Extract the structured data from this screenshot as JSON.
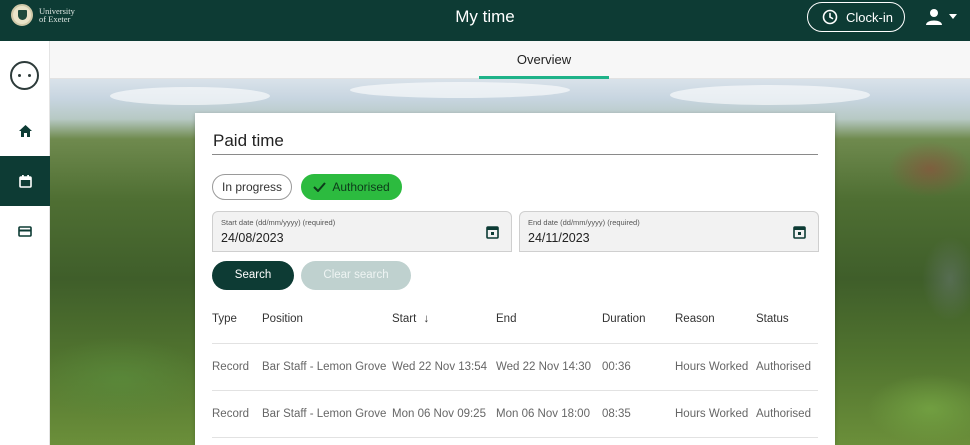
{
  "header": {
    "logo_text_line1": "University",
    "logo_text_line2": "of Exeter",
    "title": "My time",
    "clockin_label": "Clock-in"
  },
  "sidebar": {
    "items": [
      {
        "name": "home",
        "icon": "home-icon",
        "active": false
      },
      {
        "name": "calendar",
        "icon": "calendar-icon",
        "active": true
      },
      {
        "name": "card",
        "icon": "card-icon",
        "active": false
      }
    ]
  },
  "tabs": [
    {
      "label": "Overview",
      "active": true
    }
  ],
  "card": {
    "title": "Paid time",
    "filters": {
      "in_progress": "In progress",
      "authorised": "Authorised"
    },
    "start_date": {
      "label": "Start date (dd/mm/yyyy) (required)",
      "value": "24/08/2023"
    },
    "end_date": {
      "label": "End date (dd/mm/yyyy) (required)",
      "value": "24/11/2023"
    },
    "search_label": "Search",
    "clear_label": "Clear search",
    "table": {
      "columns": [
        "Type",
        "Position",
        "Start",
        "End",
        "Duration",
        "Reason",
        "Status"
      ],
      "sort_indicator": "↓",
      "rows": [
        [
          "Record",
          "Bar Staff - Lemon Grove",
          "Wed 22 Nov 13:54",
          "Wed 22 Nov 14:30",
          "00:36",
          "Hours Worked",
          "Authorised"
        ],
        [
          "Record",
          "Bar Staff - Lemon Grove",
          "Mon 06 Nov 09:25",
          "Mon 06 Nov 18:00",
          "08:35",
          "Hours Worked",
          "Authorised"
        ]
      ]
    }
  },
  "colors": {
    "header_bg": "#0d3b34",
    "accent_tab": "#1fb389",
    "authorised_chip": "#2cbb3f"
  }
}
